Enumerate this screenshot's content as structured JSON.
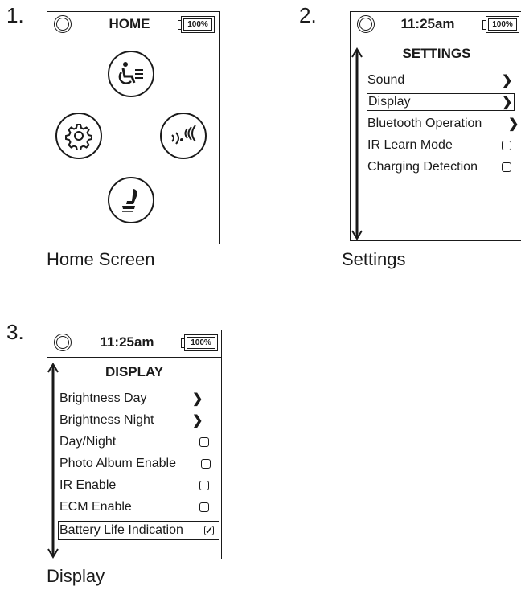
{
  "panels": [
    {
      "number": "1.",
      "caption": "Home Screen",
      "status": {
        "title": "HOME",
        "battery": "100%"
      },
      "icons": [
        "wheelchair-drive-icon",
        "settings-gear-icon",
        "wireless-signal-icon",
        "seat-icon"
      ]
    },
    {
      "number": "2.",
      "caption": "Settings",
      "status": {
        "title": "11:25am",
        "battery": "100%"
      },
      "screen_title": "SETTINGS",
      "items": [
        {
          "label": "Sound",
          "control": "chevron"
        },
        {
          "label": "Display",
          "control": "chevron",
          "selected": true
        },
        {
          "label": "Bluetooth Operation",
          "control": "chevron"
        },
        {
          "label": "IR Learn Mode",
          "control": "checkbox",
          "checked": false
        },
        {
          "label": "Charging Detection",
          "control": "checkbox",
          "checked": false
        }
      ]
    },
    {
      "number": "3.",
      "caption": "Display",
      "status": {
        "title": "11:25am",
        "battery": "100%"
      },
      "screen_title": "DISPLAY",
      "items": [
        {
          "label": "Brightness Day",
          "control": "chevron"
        },
        {
          "label": "Brightness Night",
          "control": "chevron"
        },
        {
          "label": "Day/Night",
          "control": "checkbox",
          "checked": false
        },
        {
          "label": "Photo Album Enable",
          "control": "checkbox",
          "checked": false
        },
        {
          "label": "IR Enable",
          "control": "checkbox",
          "checked": false
        },
        {
          "label": "ECM Enable",
          "control": "checkbox",
          "checked": false
        },
        {
          "label": "Battery Life Indication",
          "control": "checkbox",
          "checked": true,
          "selected": true
        }
      ]
    }
  ],
  "glyphs": {
    "chevron": "❯",
    "check": "✓"
  }
}
